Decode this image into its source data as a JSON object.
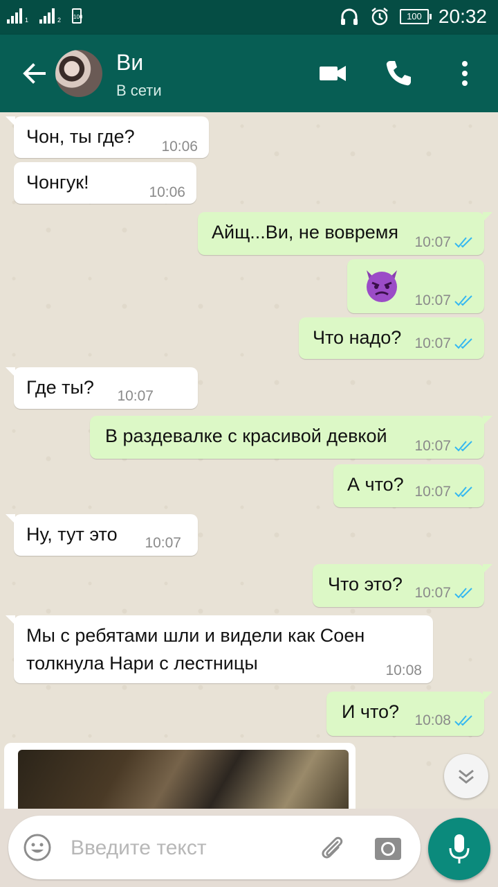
{
  "status_bar": {
    "sim1": "1",
    "sim2": "2",
    "sim_card": "100",
    "battery": "100",
    "time": "20:32"
  },
  "header": {
    "contact_name": "Ви",
    "status": "В сети"
  },
  "messages": [
    {
      "dir": "in",
      "text": "Чон, ты где?",
      "time": "10:06"
    },
    {
      "dir": "in",
      "text": "Чонгук!",
      "time": "10:06"
    },
    {
      "dir": "out",
      "text": "Айщ...Ви, не вовремя",
      "time": "10:07"
    },
    {
      "dir": "out",
      "emoji": "smiling-imp-face",
      "time": "10:07"
    },
    {
      "dir": "out",
      "text": "Что надо?",
      "time": "10:07"
    },
    {
      "dir": "in",
      "text": "Где ты?",
      "time": "10:07"
    },
    {
      "dir": "out",
      "text": "В раздевалке с красивой девкой",
      "time": "10:07"
    },
    {
      "dir": "out",
      "text": "А что?",
      "time": "10:07"
    },
    {
      "dir": "in",
      "text": "Ну, тут это",
      "time": "10:07"
    },
    {
      "dir": "out",
      "text": "Что это?",
      "time": "10:07"
    },
    {
      "dir": "in",
      "text_line1": "Мы с ребятами шли и видели как Соен",
      "text_line2": "толкнула Нари с лестницы",
      "time": "10:08"
    },
    {
      "dir": "out",
      "text": "И что?",
      "time": "10:08"
    },
    {
      "dir": "in",
      "type": "image"
    }
  ],
  "input": {
    "placeholder": "Введите текст"
  },
  "colors": {
    "header": "#075e54",
    "statusbar": "#054d44",
    "outgoing_bubble": "#dcf8c6",
    "incoming_bubble": "#ffffff",
    "read_ticks": "#34b7f1",
    "fab": "#0b8a7c"
  },
  "icons": [
    "back-arrow-icon",
    "video-call-icon",
    "phone-icon",
    "more-vert-icon",
    "double-check-icon",
    "emoji-icon",
    "attach-icon",
    "camera-icon",
    "mic-icon",
    "chevron-down-icon"
  ]
}
